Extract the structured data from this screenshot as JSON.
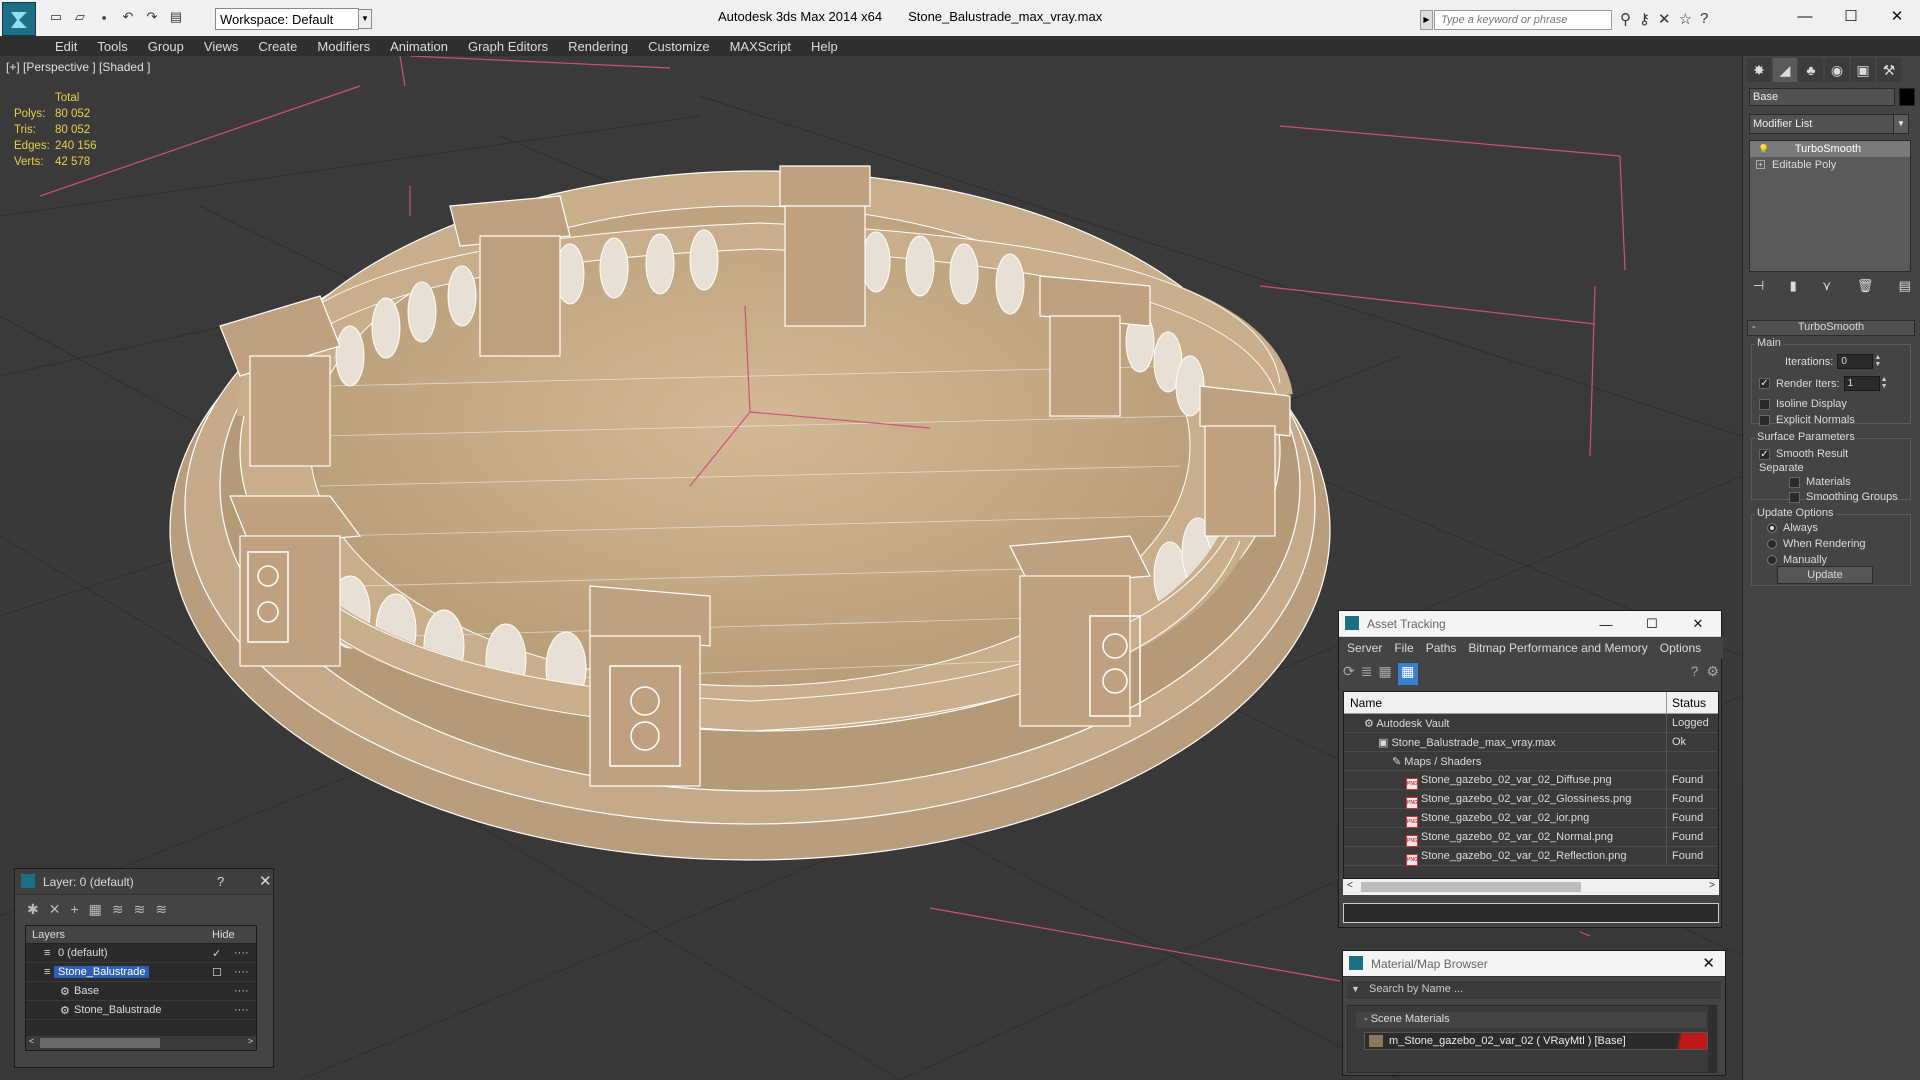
{
  "app": {
    "title": "Autodesk 3ds Max  2014 x64",
    "filename": "Stone_Balustrade_max_vray.max",
    "workspace": "Workspace: Default",
    "search_placeholder": "Type a keyword or phrase"
  },
  "menu": [
    "Edit",
    "Tools",
    "Group",
    "Views",
    "Create",
    "Modifiers",
    "Animation",
    "Graph Editors",
    "Rendering",
    "Customize",
    "MAXScript",
    "Help"
  ],
  "viewport": {
    "label": "[+] [Perspective ] [Shaded ]",
    "stats": {
      "header": "Total",
      "rows": [
        {
          "key": "Polys:",
          "value": "80 052"
        },
        {
          "key": "Tris:",
          "value": "80 052"
        },
        {
          "key": "Edges:",
          "value": "240 156"
        },
        {
          "key": "Verts:",
          "value": "42 578"
        }
      ]
    }
  },
  "command_panel": {
    "object_name": "Base",
    "modifier_list": "Modifier List",
    "stack": [
      "TurboSmooth",
      "Editable Poly"
    ],
    "turbosmooth": {
      "title": "TurboSmooth",
      "main_label": "Main",
      "iterations_label": "Iterations:",
      "iterations": "0",
      "render_iters_label": "Render Iters:",
      "render_iters": "1",
      "isoline": "Isoline Display",
      "explicit_normals": "Explicit Normals",
      "surface_label": "Surface Parameters",
      "smooth_result": "Smooth Result",
      "separate_label": "Separate",
      "materials": "Materials",
      "smoothing_groups": "Smoothing Groups",
      "update_label": "Update Options",
      "always": "Always",
      "when_rendering": "When Rendering",
      "manually": "Manually",
      "update_button": "Update"
    }
  },
  "layers": {
    "title": "Layer: 0 (default)",
    "help": "?",
    "col_layers": "Layers",
    "col_hide": "Hide",
    "rows": [
      "0 (default)",
      "Stone_Balustrade",
      "Base",
      "Stone_Balustrade"
    ]
  },
  "asset_tracking": {
    "title": "Asset Tracking",
    "menu": [
      "Server",
      "File",
      "Paths",
      "Bitmap Performance and Memory",
      "Options"
    ],
    "col_name": "Name",
    "col_status": "Status",
    "rows": [
      {
        "name": "Autodesk Vault",
        "status": "Logged"
      },
      {
        "name": "Stone_Balustrade_max_vray.max",
        "status": "Ok"
      },
      {
        "name": "Maps / Shaders",
        "status": ""
      },
      {
        "name": "Stone_gazebo_02_var_02_Diffuse.png",
        "status": "Found"
      },
      {
        "name": "Stone_gazebo_02_var_02_Glossiness.png",
        "status": "Found"
      },
      {
        "name": "Stone_gazebo_02_var_02_ior.png",
        "status": "Found"
      },
      {
        "name": "Stone_gazebo_02_var_02_Normal.png",
        "status": "Found"
      },
      {
        "name": "Stone_gazebo_02_var_02_Reflection.png",
        "status": "Found"
      }
    ]
  },
  "material_browser": {
    "title": "Material/Map Browser",
    "search": "Search by Name ...",
    "group": "- Scene Materials",
    "material": "m_Stone_gazebo_02_var_02  ( VRayMtl )  [Base]"
  },
  "colors": {
    "accent": "#2d5fb5",
    "stats_text": "#e6d24c",
    "stone": "#c7ae8c",
    "logo": "#1c6f84"
  }
}
